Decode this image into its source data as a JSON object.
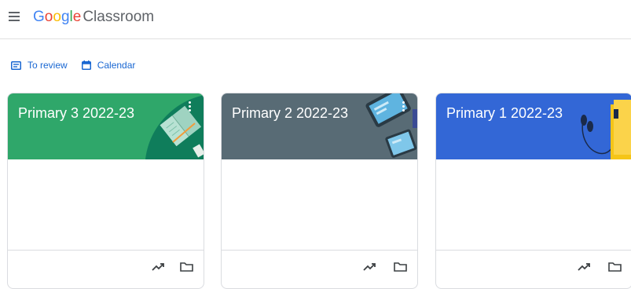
{
  "app": {
    "brand": [
      "G",
      "o",
      "o",
      "g",
      "l",
      "e"
    ],
    "product": "Classroom"
  },
  "actions": {
    "to_review": "To review",
    "calendar": "Calendar"
  },
  "cards": [
    {
      "title": "Primary 3 2022-23",
      "color": "#2fa76a"
    },
    {
      "title": "Primary 2 2022-23",
      "color": "#586b75"
    },
    {
      "title": "Primary 1 2022-23",
      "color": "#3367d6"
    }
  ],
  "icons": {
    "menu": "menu-icon",
    "to_review": "assignment-icon",
    "calendar": "calendar-icon",
    "trend": "trending-up-icon",
    "folder": "folder-icon",
    "more": "more-vert-icon"
  }
}
